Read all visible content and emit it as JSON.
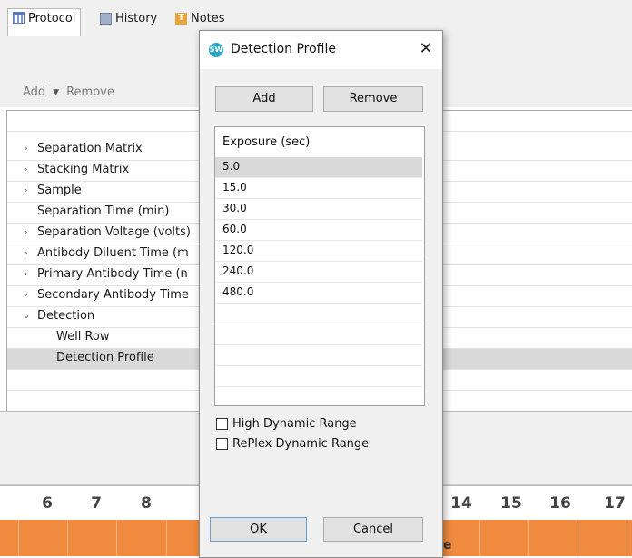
{
  "tabs": [
    {
      "label": "Protocol",
      "icon": "grid-icon"
    },
    {
      "label": "History",
      "icon": "history-icon"
    },
    {
      "label": "Notes",
      "icon": "notes-icon"
    }
  ],
  "toolbar": {
    "add_label": "Add",
    "remove_label": "Remove"
  },
  "tree": {
    "items": [
      {
        "label": "Separation Matrix",
        "expanded": false
      },
      {
        "label": "Stacking Matrix",
        "expanded": false
      },
      {
        "label": "Sample",
        "expanded": false
      },
      {
        "label": "Separation Time (min)"
      },
      {
        "label": "Separation Voltage (volts)",
        "expanded": false
      },
      {
        "label": "Antibody Diluent Time (m",
        "expanded": false
      },
      {
        "label": "Primary Antibody Time (n",
        "expanded": false
      },
      {
        "label": "Secondary Antibody Time",
        "expanded": false
      },
      {
        "label": "Detection",
        "expanded": true
      },
      {
        "label": "Well Row"
      },
      {
        "label": "Detection Profile",
        "selected": true
      }
    ]
  },
  "columns": [
    "6",
    "7",
    "8",
    "14",
    "15",
    "16",
    "17"
  ],
  "bottom_fragment": "e",
  "dialog": {
    "title": "Detection Profile",
    "logo_text": "SW",
    "add_label": "Add",
    "remove_label": "Remove",
    "column_header": "Exposure (sec)",
    "exposures": [
      "5.0",
      "15.0",
      "30.0",
      "60.0",
      "120.0",
      "240.0",
      "480.0"
    ],
    "selected_index": 0,
    "checkboxes": [
      {
        "label": "High Dynamic Range",
        "checked": false
      },
      {
        "label": "RePlex Dynamic Range",
        "checked": false
      }
    ],
    "ok_label": "OK",
    "cancel_label": "Cancel"
  },
  "colors": {
    "accent_orange": "#ef8a3e",
    "selection_gray": "#d9d9d9",
    "logo_blue": "#2aa6c8"
  }
}
